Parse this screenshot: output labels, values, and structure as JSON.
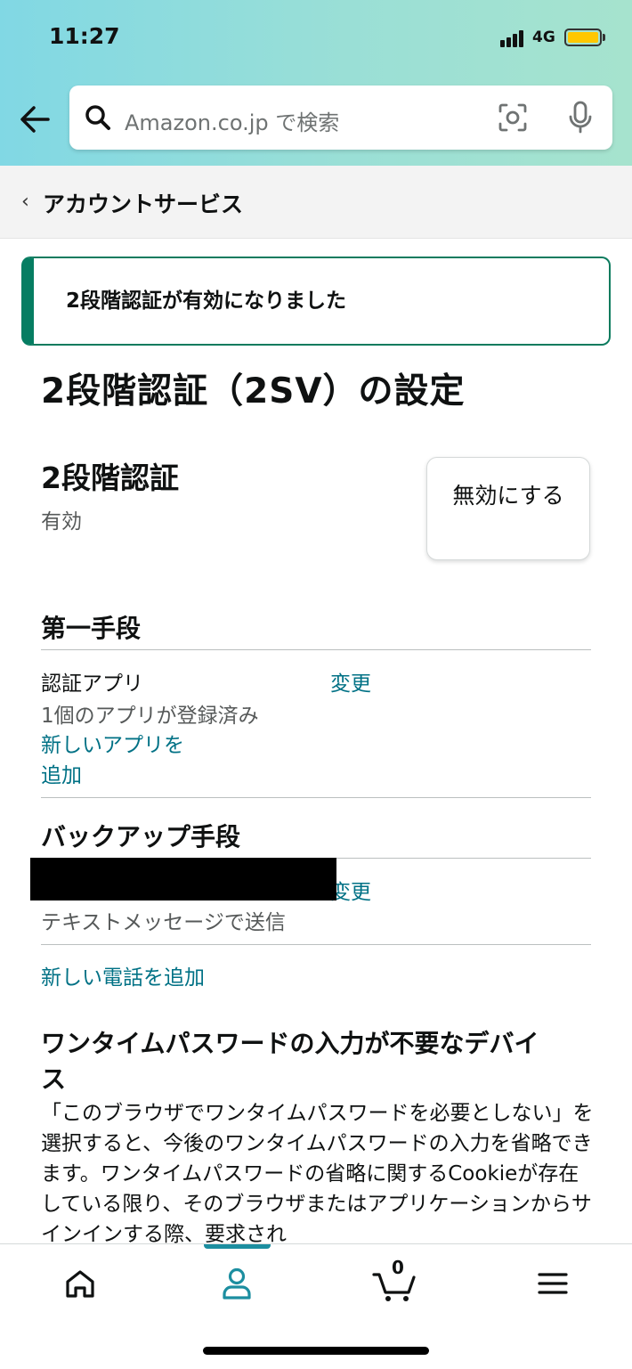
{
  "status_bar": {
    "time": "11:27",
    "network": "4G"
  },
  "search": {
    "placeholder": "Amazon.co.jp で検索"
  },
  "breadcrumb": {
    "label": "アカウントサービス"
  },
  "alert": {
    "message": "2段階認証が有効になりました"
  },
  "page": {
    "title": "2段階認証（2SV）の設定"
  },
  "two_step": {
    "title": "2段階認証",
    "status": "有効",
    "disable_label": "無効にする"
  },
  "primary": {
    "title": "第一手段",
    "method": "認証アプリ",
    "detail": "1個のアプリが登録済み",
    "change_label": "変更",
    "add_app_label_line1": "新しいアプリを",
    "add_app_label_line2": "追加"
  },
  "backup": {
    "title": "バックアップ手段",
    "change_label": "変更",
    "detail": "テキストメッセージで送信",
    "add_phone_label": "新しい電話を追加"
  },
  "devices": {
    "title_line1": "ワンタイムパスワードの入力が不要なデバイ",
    "title_line2": "ス",
    "paragraph": "「このブラウザでワンタイムパスワードを必要としない」を選択すると、今後のワンタイムパスワードの入力を省略できます。ワンタイムパスワードの省略に関するCookieが存在している限り、そのブラウザまたはアプリケーションからサインインする際、要求され"
  },
  "bottom_nav": {
    "cart_count": "0",
    "active": "account"
  },
  "colors": {
    "link": "#007185",
    "success": "#067d62",
    "nav_accent": "#1c8ea0"
  }
}
